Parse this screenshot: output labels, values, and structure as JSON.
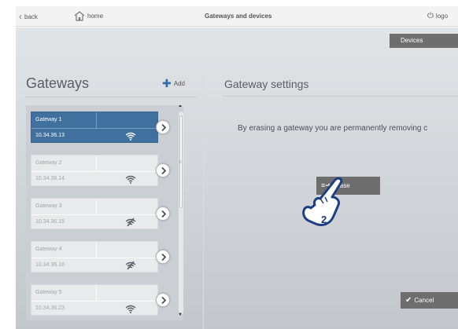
{
  "topbar": {
    "back_label": "back",
    "home_label": "home",
    "title": "Gateways and devices",
    "logout_label": "logo"
  },
  "devices_tab_label": "Devices",
  "left": {
    "title": "Gateways",
    "add_label": "Add"
  },
  "gateways": [
    {
      "name": "Gateway 1",
      "ip": "10.34.36.13",
      "signal": "wifi-icon",
      "selected": true
    },
    {
      "name": "Gateway 2",
      "ip": "10.34.36.14",
      "signal": "wifi-icon",
      "selected": false
    },
    {
      "name": "Gateway 3",
      "ip": "10.34.36.15",
      "signal": "wifi-off-icon",
      "selected": false
    },
    {
      "name": "Gateway 4",
      "ip": "10.34.36.16",
      "signal": "wifi-off-icon",
      "selected": false
    },
    {
      "name": "Gateway 5",
      "ip": "10.34.36.23",
      "signal": "wifi-icon",
      "selected": false
    }
  ],
  "right": {
    "title": "Gateway settings",
    "info_text": "By erasing a gateway you are permanently removing c",
    "erase_label": "Erase",
    "cancel_label": "Cancel"
  },
  "annotation": {
    "step_number": "2"
  },
  "colors": {
    "selected_card": "#3f709e",
    "button_gray": "#6e6e6e",
    "accent_blue": "#2f6ea8"
  }
}
